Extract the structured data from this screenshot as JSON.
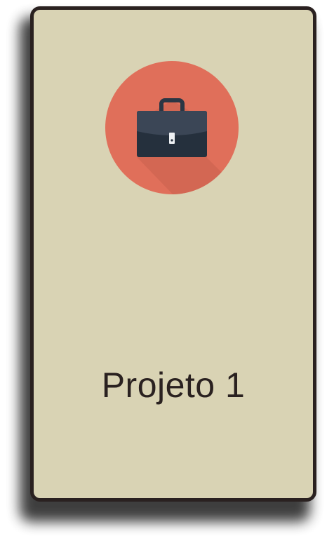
{
  "card": {
    "title": "Projeto 1",
    "icon": "briefcase-icon"
  },
  "colors": {
    "card_background": "#d9d3b4",
    "card_border": "#2a2120",
    "icon_circle": "#e06f5a",
    "briefcase": "#2b3644",
    "title_text": "#2a2120"
  }
}
